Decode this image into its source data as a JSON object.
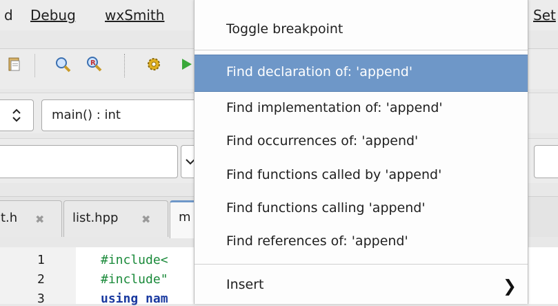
{
  "menubar": {
    "partial_left": "d",
    "debug": "Debug",
    "wxsmith": "wxSmith",
    "partial_right": "Set"
  },
  "toolbar": {
    "icons": [
      "paste-icon",
      "find-icon",
      "replace-icon",
      "gear-icon",
      "run-icon"
    ]
  },
  "scope_combo": {
    "value": "main() : int"
  },
  "tabs": [
    {
      "label": "t.h",
      "close": "✖"
    },
    {
      "label": "list.hpp",
      "close": "✖"
    },
    {
      "label": "m",
      "close": ""
    }
  ],
  "editor": {
    "lines": [
      {
        "num": "1",
        "code": "#include<"
      },
      {
        "num": "2",
        "code": "#include\""
      },
      {
        "num": "3",
        "code": "using nam"
      }
    ]
  },
  "context_menu": {
    "items": [
      {
        "label": "Toggle breakpoint"
      },
      {
        "label": "Find declaration of: 'append'"
      },
      {
        "label": "Find implementation of: 'append'"
      },
      {
        "label": "Find occurrences of: 'append'"
      },
      {
        "label": "Find functions called by 'append'"
      },
      {
        "label": "Find functions calling 'append'"
      },
      {
        "label": "Find references of: 'append'"
      },
      {
        "label": "Insert",
        "submenu_arrow": "❯"
      }
    ]
  },
  "colors": {
    "highlight": "#6e97c8",
    "code_green": "#1a8a3a"
  }
}
